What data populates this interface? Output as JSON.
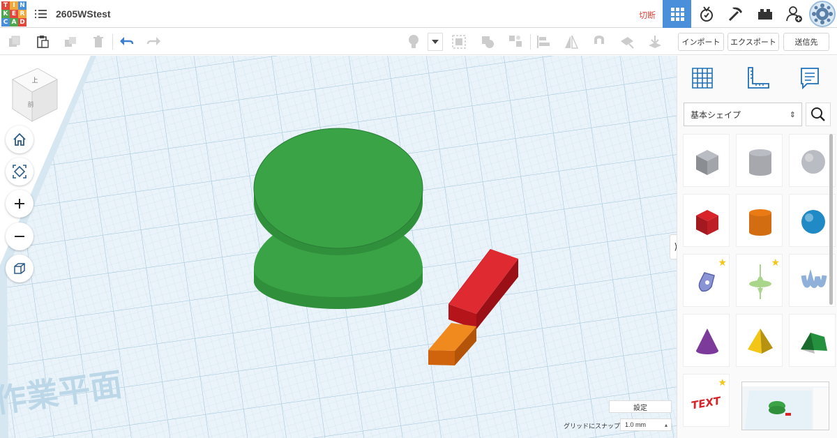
{
  "app": {
    "logo_letters": [
      "T",
      "I",
      "N",
      "K",
      "E",
      "R",
      "C",
      "A",
      "D"
    ],
    "logo_colors": [
      "#e2473b",
      "#f2a93b",
      "#4a8fd9",
      "#4fa84f",
      "#e2473b",
      "#f2a93b",
      "#4a8fd9",
      "#4fa84f",
      "#e2473b"
    ],
    "design_title": "2605WStest"
  },
  "topbar": {
    "cut_label": "切断",
    "icons": [
      "grid-view-icon",
      "simulate-icon",
      "minecraft-pickaxe-icon",
      "lego-brick-icon",
      "add-user-icon",
      "profile-avatar"
    ]
  },
  "toolbar": {
    "import_label": "インポート",
    "export_label": "エクスポート",
    "send_label": "送信先"
  },
  "viewcube": {
    "top_label": "上",
    "front_label": "前"
  },
  "workplane": {
    "watermark": "作業平面",
    "settings_label": "設定",
    "snap_label": "グリッドにスナップ",
    "snap_value": "1.0 mm"
  },
  "sidebar": {
    "shape_category": "基本シェイプ",
    "shapes": [
      {
        "name": "box-hole",
        "color": "#b9bcc2",
        "kind": "box",
        "favorite": false
      },
      {
        "name": "cylinder-hole",
        "color": "#b9bcc2",
        "kind": "cylinder",
        "favorite": false
      },
      {
        "name": "sphere-hole",
        "color": "#b9bcc2",
        "kind": "sphere",
        "favorite": false
      },
      {
        "name": "box",
        "color": "#d9232b",
        "kind": "box",
        "favorite": false
      },
      {
        "name": "cylinder",
        "color": "#ea7a14",
        "kind": "cylinder",
        "favorite": false
      },
      {
        "name": "sphere",
        "color": "#1f8ac6",
        "kind": "sphere",
        "favorite": false
      },
      {
        "name": "scribble",
        "color": "#8a94d4",
        "kind": "scribble",
        "favorite": true
      },
      {
        "name": "shape-generator",
        "color": "#a9d68a",
        "kind": "spinner",
        "favorite": true
      },
      {
        "name": "text-3d",
        "color": "#8fb0d9",
        "kind": "squiggle",
        "favorite": false
      },
      {
        "name": "cone",
        "color": "#7c3a9a",
        "kind": "cone",
        "favorite": false
      },
      {
        "name": "pyramid",
        "color": "#f2c516",
        "kind": "pyramid",
        "favorite": false
      },
      {
        "name": "roof",
        "color": "#23913e",
        "kind": "roof",
        "favorite": false
      },
      {
        "name": "text",
        "color": "#d9232b",
        "kind": "text",
        "favorite": true
      }
    ],
    "text_shape_label": "TEXT"
  },
  "scene_objects": [
    {
      "name": "green-cylinder-bottom",
      "color": "#3aa346"
    },
    {
      "name": "green-cylinder-top",
      "color": "#3aa346"
    },
    {
      "name": "red-box",
      "color": "#d9232b"
    },
    {
      "name": "orange-box",
      "color": "#ea7a14"
    }
  ]
}
